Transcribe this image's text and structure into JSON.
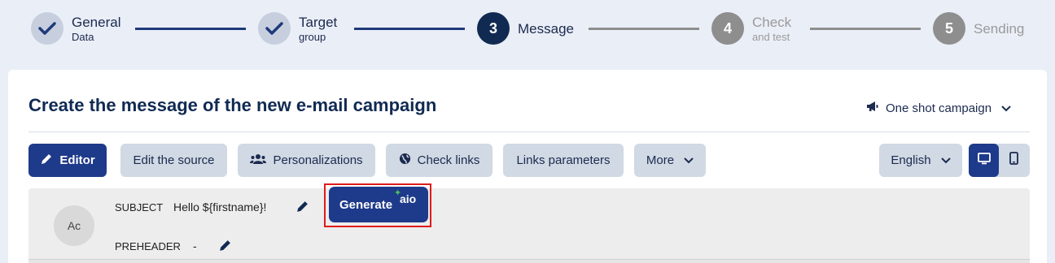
{
  "stepper": {
    "steps": [
      {
        "number": "",
        "title": "General",
        "subtitle": "Data",
        "state": "done"
      },
      {
        "number": "",
        "title": "Target",
        "subtitle": "group",
        "state": "done"
      },
      {
        "number": "3",
        "title": "Message",
        "subtitle": "",
        "state": "active"
      },
      {
        "number": "4",
        "title": "Check",
        "subtitle": "and test",
        "state": "pending"
      },
      {
        "number": "5",
        "title": "Sending",
        "subtitle": "",
        "state": "pending"
      }
    ]
  },
  "card": {
    "title": "Create the message of the new e-mail campaign",
    "campaign_type": "One shot campaign"
  },
  "toolbar": {
    "editor": "Editor",
    "edit_source": "Edit the source",
    "personalizations": "Personalizations",
    "check_links": "Check links",
    "links_parameters": "Links parameters",
    "more": "More",
    "language": "English"
  },
  "message": {
    "avatar_initials": "Ac",
    "subject_label": "SUBJECT",
    "subject_value": "Hello ${firstname}!",
    "preheader_label": "PREHEADER",
    "preheader_value": "-",
    "generate_label": "Generate",
    "generate_brand": "aio"
  },
  "colors": {
    "primary": "#1e3a8a",
    "navy": "#102a52",
    "highlight": "#e01a1a",
    "page_bg": "#eaeef7"
  }
}
